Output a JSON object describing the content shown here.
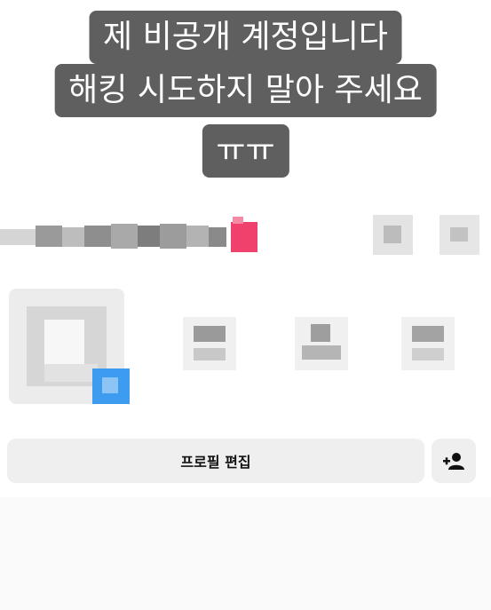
{
  "caption": {
    "lines": [
      "제 비공개 계정입니다",
      "해킹 시도하지 말아 주세요",
      "ㅠㅠ"
    ]
  },
  "profile": {
    "edit_button_label": "프로필 편집",
    "add_person_icon": "person-add-icon"
  },
  "colors": {
    "caption_bg": "#5f5f5f",
    "button_bg": "#efefef",
    "accent_red": "#f0416c",
    "accent_blue": "#3d9bf0"
  }
}
